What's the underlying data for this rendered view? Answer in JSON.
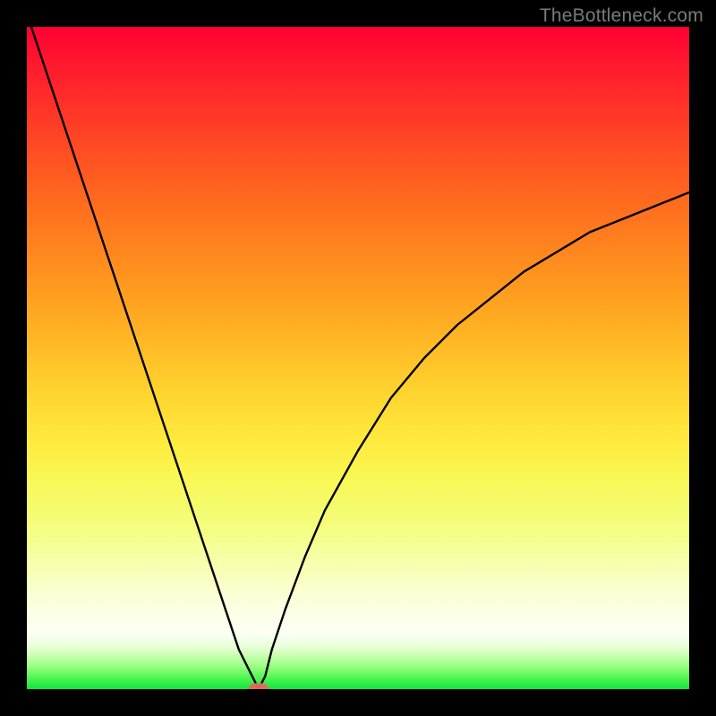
{
  "watermark": "TheBottleneck.com",
  "chart_data": {
    "type": "line",
    "title": "",
    "xlabel": "",
    "ylabel": "",
    "xlim": [
      0,
      100
    ],
    "ylim": [
      0,
      100
    ],
    "x": [
      0,
      3,
      6,
      9,
      12,
      15,
      18,
      21,
      24,
      27,
      30,
      32,
      34,
      35,
      36,
      37,
      39,
      42,
      45,
      50,
      55,
      60,
      65,
      70,
      75,
      80,
      85,
      90,
      95,
      100
    ],
    "values": [
      102,
      93,
      84,
      75,
      66,
      57,
      48,
      39,
      30,
      21,
      12,
      6,
      2,
      0,
      2,
      6,
      12,
      20,
      27,
      36,
      44,
      50,
      55,
      59,
      63,
      66,
      69,
      71,
      73,
      75
    ],
    "optimum": {
      "x": 35,
      "y": 0
    },
    "marker_visible": true,
    "background_gradient_description": "vertical red→orange→yellow→pale→green heatmap"
  }
}
